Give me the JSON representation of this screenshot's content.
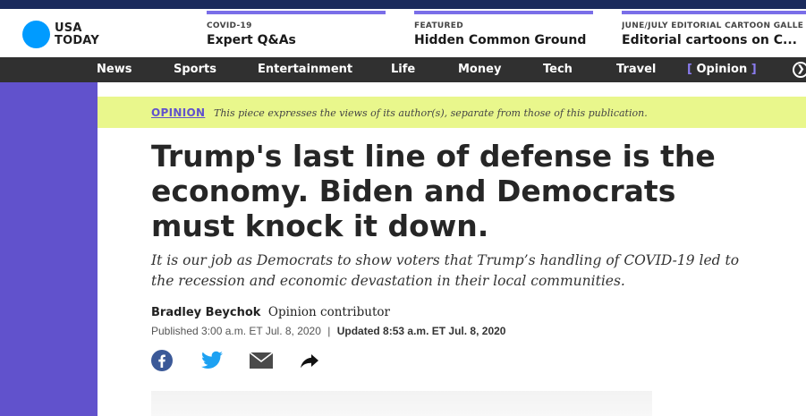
{
  "brand": {
    "line1": "USA",
    "line2": "TODAY"
  },
  "promos": [
    {
      "kicker": "COVID-19",
      "title": "Expert Q&As"
    },
    {
      "kicker": "FEATURED",
      "title": "Hidden Common Ground"
    },
    {
      "kicker": "JUNE/JULY EDITORIAL CARTOON GALLE",
      "title": "Editorial cartoons on C..."
    }
  ],
  "nav": {
    "items": [
      "News",
      "Sports",
      "Entertainment",
      "Life",
      "Money",
      "Tech",
      "Travel"
    ],
    "active": {
      "open": "[",
      "label": "Opinion",
      "close": "]"
    }
  },
  "opinion_banner": {
    "label": "OPINION",
    "note": "This piece expresses the views of its author(s), separate from those of this publication."
  },
  "article": {
    "headline": "Trump's last line of defense is the economy. Biden and Democrats must knock it down.",
    "dek": "It is our job as Democrats to show voters that Trump’s handling of COVID-19 led to the recession and economic devastation in their local communities.",
    "author": "Bradley Beychok",
    "author_role": "Opinion contributor",
    "published": "Published 3:00 a.m. ET Jul. 8, 2020",
    "separator": "|",
    "updated": "Updated 8:53 a.m. ET Jul. 8, 2020"
  },
  "colors": {
    "accent": "#6152cc",
    "logo": "#009bff",
    "banner": "#e9f78c",
    "nav_bg": "#303030",
    "facebook": "#3b5998",
    "twitter": "#1da1f2"
  },
  "icons": [
    "facebook-icon",
    "twitter-icon",
    "email-icon",
    "share-icon",
    "search-icon"
  ]
}
